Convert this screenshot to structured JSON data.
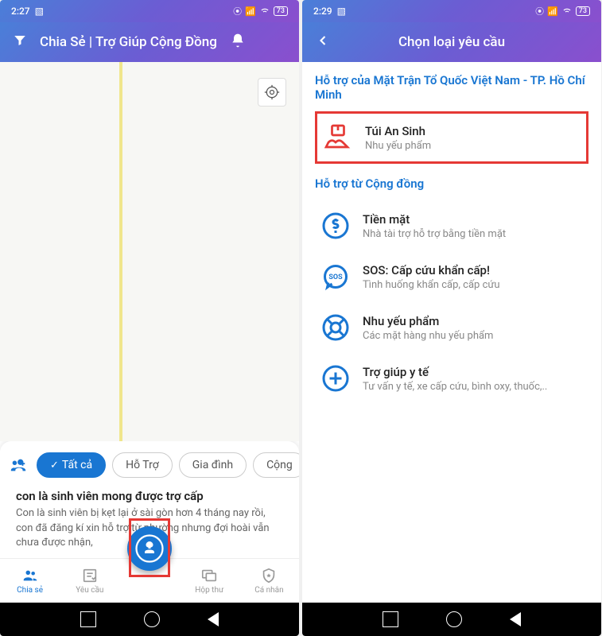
{
  "left": {
    "status": {
      "time": "2:27",
      "battery": "73"
    },
    "header": {
      "title": "Chia Sẻ | Trợ Giúp Cộng Đồng"
    },
    "chips": {
      "all": "Tất cả",
      "support": "Hỗ Trợ",
      "family": "Gia đình",
      "community": "Cộng"
    },
    "post": {
      "title": "con là sinh viên mong được trợ cấp",
      "body": "Con là sinh viên bị kẹt lại ở sài gòn hơn 4 tháng nay rồi, con đã đăng kí xin hỗ trợ từ phường nhưng đợi hoài vẫn chưa được nhận,"
    },
    "nav": {
      "share": "Chia sẻ",
      "request": "Yêu cầu",
      "inbox": "Hộp thư",
      "profile": "Cá nhân"
    }
  },
  "right": {
    "status": {
      "time": "2:29",
      "battery": "73"
    },
    "header": {
      "title": "Chọn loại yêu cầu"
    },
    "section1": "Hỗ trợ của Mặt Trận Tổ Quốc Việt Nam - TP. Hồ Chí Minh",
    "item1": {
      "title": "Túi An Sinh",
      "sub": "Nhu yếu phẩm"
    },
    "section2": "Hỗ trợ từ Cộng đồng",
    "item2": {
      "title": "Tiền mặt",
      "sub": "Nhà tài trợ hỗ trợ bằng tiền mặt"
    },
    "item3": {
      "title": "SOS: Cấp cứu khẩn cấp!",
      "sub": "Tình huống khẩn cấp, cấp cứu"
    },
    "item4": {
      "title": "Nhu yếu phẩm",
      "sub": "Các mặt hàng nhu yếu phẩm"
    },
    "item5": {
      "title": "Trợ giúp y tế",
      "sub": "Tư vấn y tế, xe cấp cứu, bình oxy, thuốc,.."
    }
  }
}
